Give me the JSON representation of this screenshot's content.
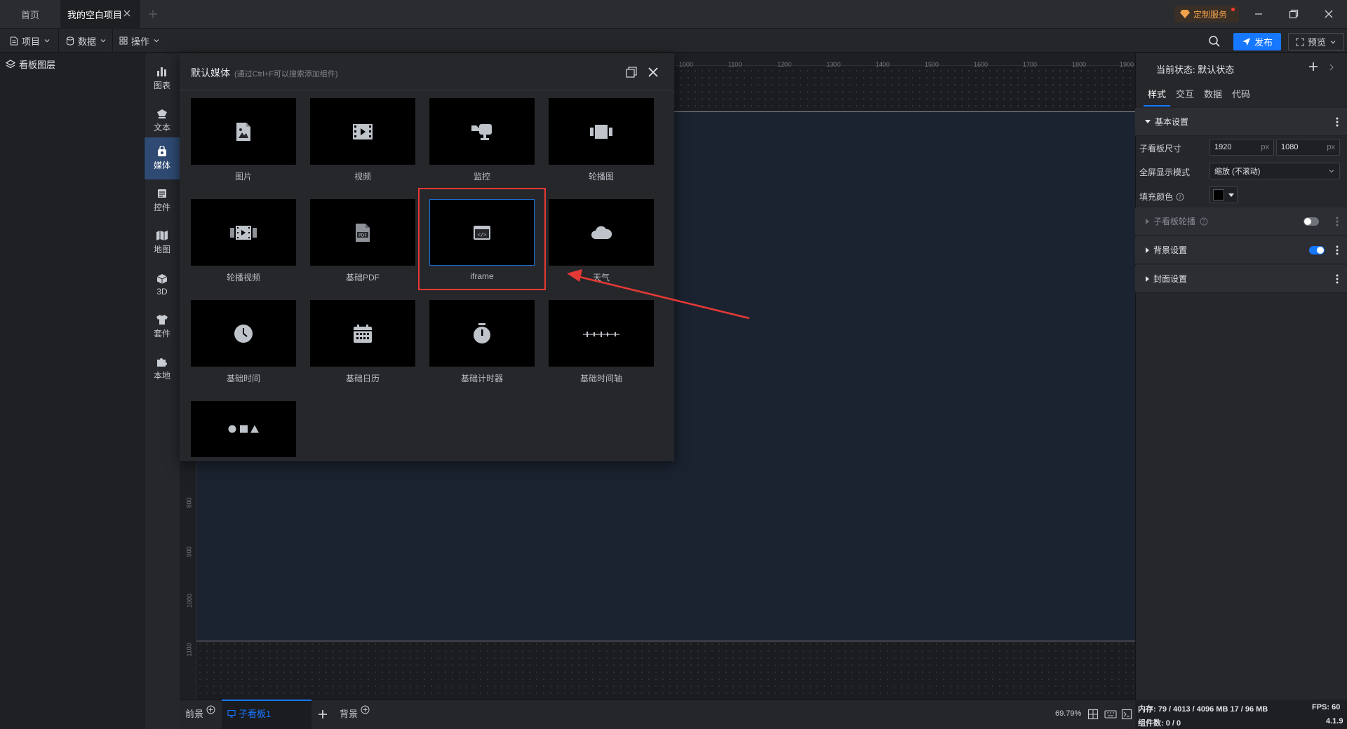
{
  "titlebar": {
    "tabs": [
      {
        "label": "首页"
      },
      {
        "label": "我的空白项目"
      }
    ],
    "custom_service": "定制服务"
  },
  "menubar": {
    "menus": [
      {
        "label": "项目"
      },
      {
        "label": "数据"
      },
      {
        "label": "操作"
      }
    ],
    "publish": "发布",
    "preview": "预览"
  },
  "layers": {
    "title": "看板图层"
  },
  "categories": [
    {
      "label": "图表",
      "icon": "bar-chart-icon"
    },
    {
      "label": "文本",
      "icon": "text-icon"
    },
    {
      "label": "媒体",
      "icon": "media-icon"
    },
    {
      "label": "控件",
      "icon": "widget-icon"
    },
    {
      "label": "地图",
      "icon": "map-icon"
    },
    {
      "label": "3D",
      "icon": "cube-icon"
    },
    {
      "label": "套件",
      "icon": "shirt-icon"
    },
    {
      "label": "本地",
      "icon": "puzzle-icon"
    }
  ],
  "media_panel": {
    "title": "默认媒体",
    "hint": "(通过Ctrl+F可以搜索添加组件)",
    "items": [
      {
        "label": "图片",
        "icon": "image-file-icon"
      },
      {
        "label": "视频",
        "icon": "film-icon"
      },
      {
        "label": "监控",
        "icon": "camera-icon"
      },
      {
        "label": "轮播图",
        "icon": "carousel-icon"
      },
      {
        "label": "轮播视频",
        "icon": "film-strip-icon"
      },
      {
        "label": "基础PDF",
        "icon": "pdf-icon"
      },
      {
        "label": "iframe",
        "icon": "code-window-icon"
      },
      {
        "label": "天气",
        "icon": "cloud-icon"
      },
      {
        "label": "基础时间",
        "icon": "clock-icon"
      },
      {
        "label": "基础日历",
        "icon": "calendar-icon"
      },
      {
        "label": "基础计时器",
        "icon": "stopwatch-icon"
      },
      {
        "label": "基础时间轴",
        "icon": "timeline-icon"
      },
      {
        "label": "",
        "icon": "shapes-icon"
      }
    ]
  },
  "ruler": {
    "top": [
      "1000",
      "1100",
      "1200",
      "1300",
      "1400",
      "1500",
      "1600",
      "1700",
      "1800",
      "1900"
    ],
    "left": [
      "800",
      "900",
      "1000",
      "1100"
    ]
  },
  "props": {
    "state_label": "当前状态: 默认状态",
    "tabs": [
      {
        "label": "样式"
      },
      {
        "label": "交互"
      },
      {
        "label": "数据"
      },
      {
        "label": "代码"
      }
    ],
    "basic_section": "基本设置",
    "size_label": "子看板尺寸",
    "width": "1920",
    "height": "1080",
    "unit": "px",
    "fullscreen_label": "全屏显示模式",
    "fullscreen_value": "缩放 (不滚动)",
    "fill_label": "填充颜色",
    "fill_color": "#000000",
    "carousel_section": "子看板轮播",
    "background_section": "背景设置",
    "cover_section": "封面设置"
  },
  "bottombar": {
    "foreground": "前景",
    "subboard": "子看板1",
    "background": "背景",
    "zoom": "69.79%"
  },
  "status": {
    "memory": "内存: 79 / 4013 / 4096 MB  17 / 96 MB",
    "fps": "FPS: 60",
    "components": "组件数: 0 / 0",
    "version": "4.1.9"
  },
  "colors": {
    "accent": "#1677ff",
    "highlight": "#e53935",
    "canvas": "#1b2330"
  }
}
